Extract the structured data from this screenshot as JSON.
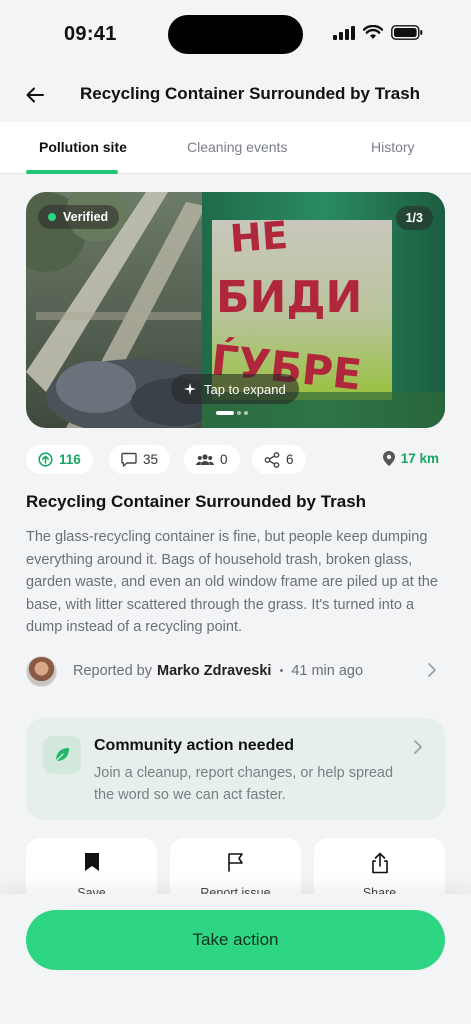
{
  "status": {
    "time": "09:41"
  },
  "header": {
    "title": "Recycling Container Surrounded by Trash"
  },
  "tabs": [
    {
      "label": "Pollution site"
    },
    {
      "label": "Cleaning events"
    },
    {
      "label": "History"
    }
  ],
  "photo": {
    "verified_label": "Verified",
    "counter": "1/3",
    "expand_label": "Tap to expand",
    "graffiti_text": "НЕ БИДИ ЃУБРЕ"
  },
  "stats": {
    "upvotes": "116",
    "comments": "35",
    "participants": "0",
    "shares": "6",
    "distance": "17 km"
  },
  "site": {
    "title": "Recycling Container Surrounded by Trash",
    "description": "The glass-recycling container is fine, but people keep dumping everything around it. Bags of household trash, broken glass, garden waste, and even an old window frame are piled up at the base, with litter scattered through the grass. It's turned into a dump instead of a recycling point."
  },
  "reporter": {
    "prefix": "Reported by",
    "name": "Marko Zdraveski",
    "separator": "•",
    "time": "41 min ago"
  },
  "community": {
    "title": "Community action needed",
    "text": "Join a cleanup, report changes, or help spread the word so we can act faster."
  },
  "actions": [
    {
      "label": "Save",
      "icon": "bookmark-icon"
    },
    {
      "label": "Report issue",
      "icon": "flag-icon"
    },
    {
      "label": "Share",
      "icon": "share-icon"
    }
  ],
  "cta": {
    "label": "Take action"
  },
  "colors": {
    "accent": "#2ed683",
    "accent_text": "#17a862",
    "community_bg": "#e6efeb"
  }
}
